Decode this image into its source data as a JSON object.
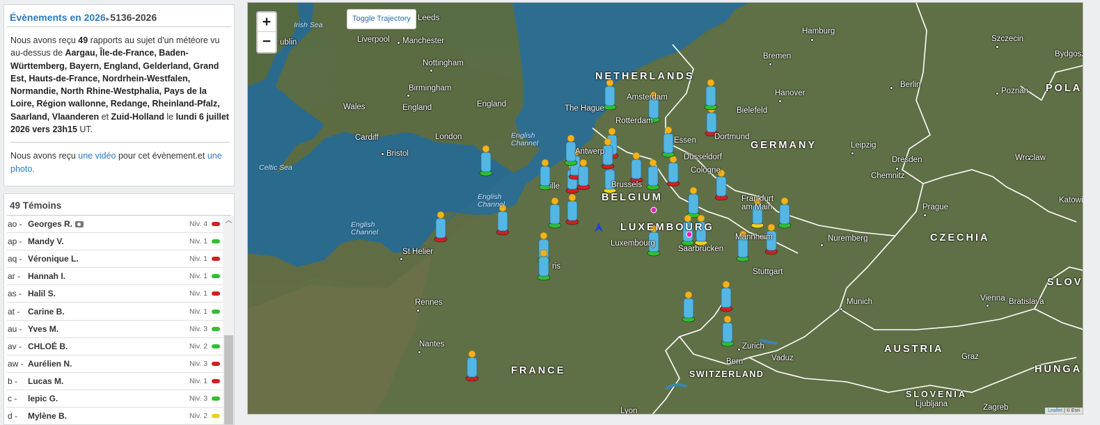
{
  "event": {
    "title_prefix": "Évènements en 2026",
    "separator": "▸",
    "event_id": "5136-2026",
    "summary": {
      "p1": "Nous avons reçu ",
      "count": "49",
      "p2": " rapports au sujet d'un météore vu au-dessus de ",
      "regions": "Aargau, Île-de-France, Baden-Württemberg, Bayern, England, Gelderland, Grand Est, Hauts-de-France, Nordrhein-Westfalen, Normandie, North Rhine-Westphalia, Pays de la Loire, Région wallonne, Redange, Rheinland-Pfalz, Saarland, Vlaanderen",
      "et": " et ",
      "last_region": "Zuid-Holland",
      "le": " le ",
      "date": "lundi 6 juillet 2026 vers 23h15",
      "ut": " UT."
    },
    "media": {
      "p1": "Nous avons reçu ",
      "video_link": "une vidéo",
      "p2": " pour cet évènement.et ",
      "photo_link": "une photo."
    }
  },
  "witnesses": {
    "header": "49 Témoins",
    "rows": [
      {
        "id": "ao -",
        "name": "Georges R.",
        "camera": true,
        "level": "Niv. 4",
        "color": "#d21f1f"
      },
      {
        "id": "ap -",
        "name": "Mandy V.",
        "camera": false,
        "level": "Niv. 1",
        "color": "#2fbf2f"
      },
      {
        "id": "aq -",
        "name": "Véronique  L.",
        "camera": false,
        "level": "Niv. 1",
        "color": "#d21f1f"
      },
      {
        "id": "ar -",
        "name": "Hannah  I.",
        "camera": false,
        "level": "Niv. 1",
        "color": "#2fbf2f"
      },
      {
        "id": "as -",
        "name": "Halil S.",
        "camera": false,
        "level": "Niv. 1",
        "color": "#d21f1f"
      },
      {
        "id": "at -",
        "name": "Carine B.",
        "camera": false,
        "level": "Niv. 1",
        "color": "#2fbf2f"
      },
      {
        "id": "au -",
        "name": "Yves M.",
        "camera": false,
        "level": "Niv. 3",
        "color": "#2fbf2f"
      },
      {
        "id": "av -",
        "name": "CHLOÉ  B.",
        "camera": false,
        "level": "Niv. 2",
        "color": "#2fbf2f"
      },
      {
        "id": "aw -",
        "name": "Aurélien N.",
        "camera": false,
        "level": "Niv. 3",
        "color": "#d21f1f"
      },
      {
        "id": "b -",
        "name": "Lucas M.",
        "camera": false,
        "level": "Niv. 1",
        "color": "#d21f1f"
      },
      {
        "id": "c -",
        "name": "lepic G.",
        "camera": false,
        "level": "Niv. 3",
        "color": "#2fbf2f"
      },
      {
        "id": "d -",
        "name": "Mylène  B.",
        "camera": false,
        "level": "Niv. 2",
        "color": "#f0d020"
      }
    ]
  },
  "map": {
    "zoom_in": "+",
    "zoom_out": "−",
    "toggle_button": "Toggle Trajectory",
    "attribution_leaflet": "Leaflet",
    "attribution_rest": " | © Esri",
    "labels": {
      "leeds": "Leeds",
      "irish_sea": "Irish Sea",
      "dublin": "ublin",
      "liverpool": "Liverpool",
      "manchester": "Manchester",
      "nottingham": "Nottingham",
      "birmingham": "Birmingham",
      "wales": "Wales",
      "england1": "England",
      "england2": "England",
      "cardiff": "Cardiff",
      "bristol": "Bristol",
      "london": "London",
      "english_channel1": "English Channel",
      "english_channel2": "English Channel",
      "english_channel3": "English Channel",
      "celtic_sea": "Celtic Sea",
      "st_helier": "St Helier",
      "rennes": "Rennes",
      "nantes": "Nantes",
      "france": "FRANCE",
      "paris": "ris",
      "netherlands": "NETHERLANDS",
      "amsterdam": "Amsterdam",
      "the_hague": "The Hague",
      "rotterdam": "Rotterdam",
      "antwerp": "Antwerp",
      "brussels": "Brussels",
      "belgium": "BELGIUM",
      "lille": "ille",
      "luxembourg_c": "LUXEMBOURG",
      "luxembourg": "Luxembourg",
      "essen": "Essen",
      "dusseldorf": "Düsseldorf",
      "cologne": "Cologne",
      "dortmund": "Dortmund",
      "bremen": "Bremen",
      "hamburg": "Hamburg",
      "hanover": "Hanover",
      "bielefeld": "Bielefeld",
      "germany": "GERMANY",
      "berlin": "Berlin",
      "leipzig": "Leipzig",
      "dresden": "Dresden",
      "chemnitz": "Chemnitz",
      "frankfurt": "Frankfurt\nam Main",
      "mannheim": "Mannheim",
      "saarbrucken": "Saarbrücken",
      "stuttgart": "Stuttgart",
      "nuremberg": "Nuremberg",
      "munich": "Munich",
      "prague": "Prague",
      "czechia": "CZECHIA",
      "szczecin": "Szczecin",
      "bydgoszcz": "Bydgoszcz",
      "poznan": "Poznan",
      "wroclaw": "Wroclaw",
      "katowice": "Katowi",
      "poland": "POLA",
      "vienna": "Vienna",
      "bratislava": "Bratislava",
      "austria": "AUSTRIA",
      "slovakia": "SLOV",
      "graz": "Graz",
      "hungary": "HUNGA",
      "slovenia": "SLOVENIA",
      "ljubljana": "Ljubljana",
      "zagreb": "Zagreb",
      "zurich": "Zurich",
      "vaduz": "Vaduz",
      "bern": "Bern",
      "switzerland": "SWITZERLAND",
      "lyon": "Lyon"
    },
    "witness_markers": [
      {
        "code": "ao",
        "color": "#d21f1f"
      },
      {
        "code": "ap",
        "color": "#2fbf2f"
      },
      {
        "code": "aq",
        "color": "#d21f1f"
      },
      {
        "code": "ar",
        "color": "#2fbf2f"
      },
      {
        "code": "as",
        "color": "#d21f1f"
      },
      {
        "code": "at",
        "color": "#2fbf2f"
      },
      {
        "code": "au",
        "color": "#2fbf2f"
      },
      {
        "code": "av",
        "color": "#2fbf2f"
      },
      {
        "code": "aw",
        "color": "#d21f1f"
      },
      {
        "code": "b",
        "color": "#d21f1f"
      },
      {
        "code": "c",
        "color": "#2fbf2f"
      },
      {
        "code": "d",
        "color": "#f0d020"
      }
    ]
  }
}
